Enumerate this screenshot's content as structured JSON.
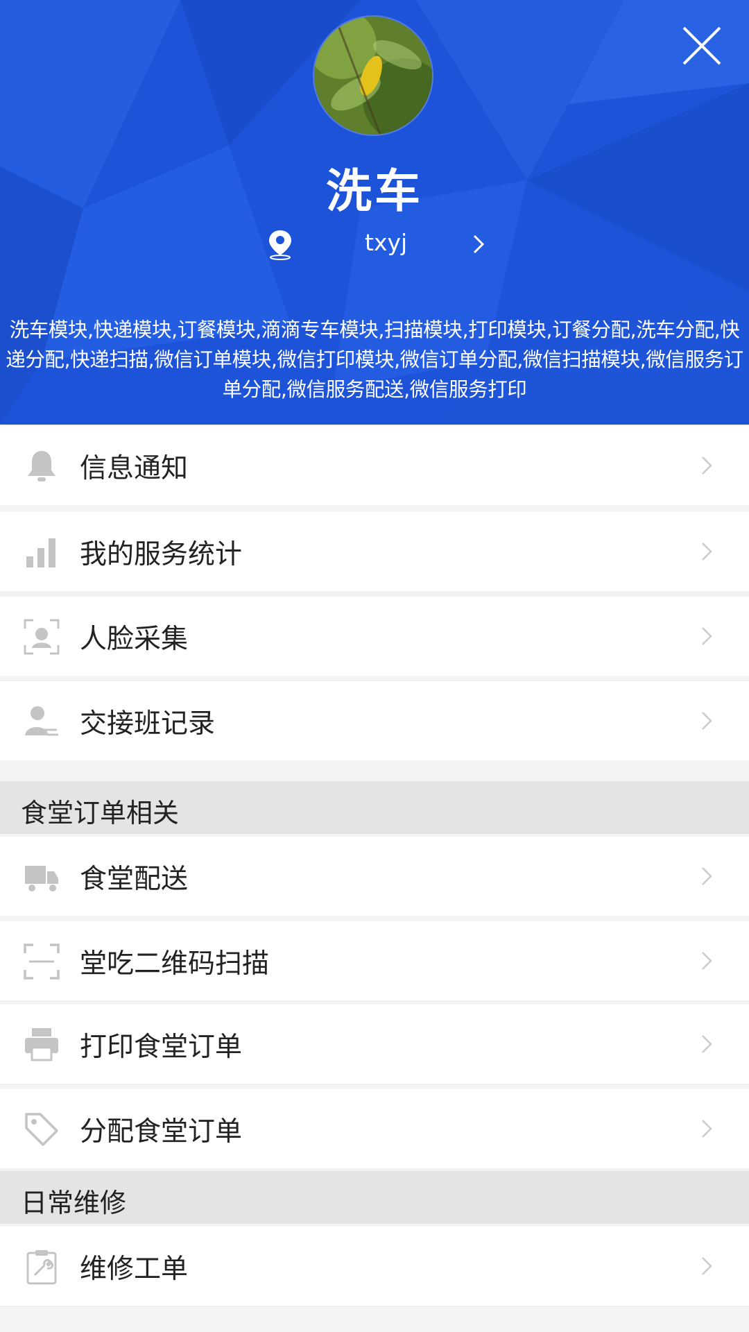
{
  "header": {
    "title": "洗车",
    "location": "txyj",
    "modules_text": "洗车模块,快递模块,订餐模块,滴滴专车模块,扫描模块,打印模块,订餐分配,洗车分配,快递分配,快递扫描,微信订单模块,微信打印模块,微信订单分配,微信扫描模块,微信服务订单分配,微信服务配送,微信服务打印",
    "background_color": "#1b52d6"
  },
  "menu": [
    {
      "label": "信息通知",
      "icon": "bell-icon"
    },
    {
      "label": "我的服务统计",
      "icon": "bar-chart-icon"
    },
    {
      "label": "人脸采集",
      "icon": "face-scan-icon"
    },
    {
      "label": "交接班记录",
      "icon": "user-handover-icon"
    }
  ],
  "sections": [
    {
      "title": "食堂订单相关",
      "items": [
        {
          "label": "食堂配送",
          "icon": "truck-icon"
        },
        {
          "label": "堂吃二维码扫描",
          "icon": "scan-icon"
        },
        {
          "label": "打印食堂订单",
          "icon": "printer-icon"
        },
        {
          "label": "分配食堂订单",
          "icon": "tag-icon"
        }
      ]
    },
    {
      "title": "日常维修",
      "items": [
        {
          "label": "维修工单",
          "icon": "repair-clipboard-icon"
        }
      ]
    }
  ]
}
